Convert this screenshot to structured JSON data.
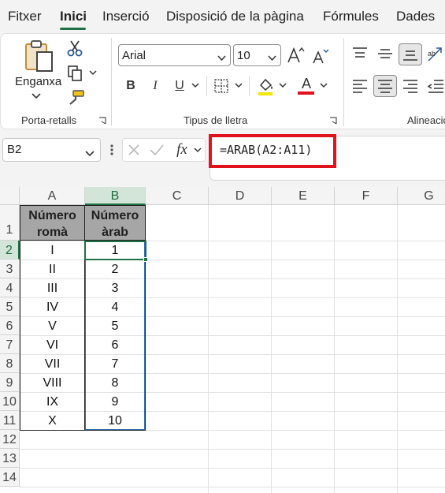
{
  "menu": {
    "tabs": [
      "Fitxer",
      "Inici",
      "Inserció",
      "Disposició de la pàgina",
      "Fórmules",
      "Dades"
    ],
    "active_tab": "Inici"
  },
  "ribbon": {
    "clipboard": {
      "paste_label": "Enganxa",
      "group_label": "Porta-retalls"
    },
    "font": {
      "font_name": "Arial",
      "font_size": "10",
      "group_label": "Tipus de lletra",
      "bold": "B",
      "italic": "I",
      "underline": "U",
      "font_color_letter": "A",
      "font_color": "#e0121c"
    },
    "alignment": {
      "group_label": "Alineació"
    }
  },
  "formula_bar": {
    "name_box": "B2",
    "fx_label": "fx",
    "formula": "=ARAB(A2:A11)"
  },
  "sheet": {
    "columns": [
      "A",
      "B",
      "C",
      "D",
      "E",
      "F",
      "G"
    ],
    "selected_column": "B",
    "rows": [
      "1",
      "2",
      "3",
      "4",
      "5",
      "6",
      "7",
      "8",
      "9",
      "10",
      "11",
      "12",
      "13",
      "14"
    ],
    "selected_row": "2",
    "header_A": {
      "line1": "Número",
      "line2": "romà"
    },
    "header_B": {
      "line1": "Número",
      "line2": "àrab"
    },
    "col_A": [
      "I",
      "II",
      "III",
      "IV",
      "V",
      "VI",
      "VII",
      "VIII",
      "IX",
      "X"
    ],
    "col_B": [
      "1",
      "2",
      "3",
      "4",
      "5",
      "6",
      "7",
      "8",
      "9",
      "10"
    ]
  },
  "colors": {
    "accent": "#1e7145",
    "highlight_border": "#e0121c",
    "header_fill": "#a6a6a6",
    "range_border": "#2f6bb3"
  }
}
